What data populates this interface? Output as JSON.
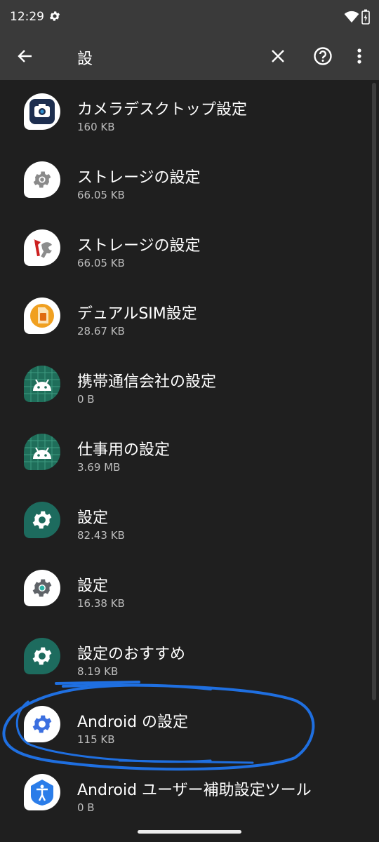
{
  "status": {
    "time": "12:29"
  },
  "search": {
    "query": "設"
  },
  "apps": [
    {
      "name": "カメラデスクトップ設定",
      "size": "160 KB",
      "icon": "camera-icon"
    },
    {
      "name": "ストレージの設定",
      "size": "66.05 KB",
      "icon": "gear-icon"
    },
    {
      "name": "ストレージの設定",
      "size": "66.05 KB",
      "icon": "tools-icon"
    },
    {
      "name": "デュアルSIM設定",
      "size": "28.67 KB",
      "icon": "sim-card-icon"
    },
    {
      "name": "携帯通信会社の設定",
      "size": "0 B",
      "icon": "android-icon"
    },
    {
      "name": "仕事用の設定",
      "size": "3.69 MB",
      "icon": "android-icon"
    },
    {
      "name": "設定",
      "size": "82.43 KB",
      "icon": "settings-icon"
    },
    {
      "name": "設定",
      "size": "16.38 KB",
      "icon": "settings-icon"
    },
    {
      "name": "設定のおすすめ",
      "size": "8.19 KB",
      "icon": "settings-icon"
    },
    {
      "name": "Android の設定",
      "size": "115 KB",
      "icon": "settings-icon"
    },
    {
      "name": "Android ユーザー補助設定ツール",
      "size": "0 B",
      "icon": "accessibility-icon"
    }
  ],
  "colors": {
    "background": "#1f1f1f",
    "toolbar": "#3a3a3a",
    "annotation": "#1f6fe0",
    "android_green": "#1f6e5a"
  }
}
